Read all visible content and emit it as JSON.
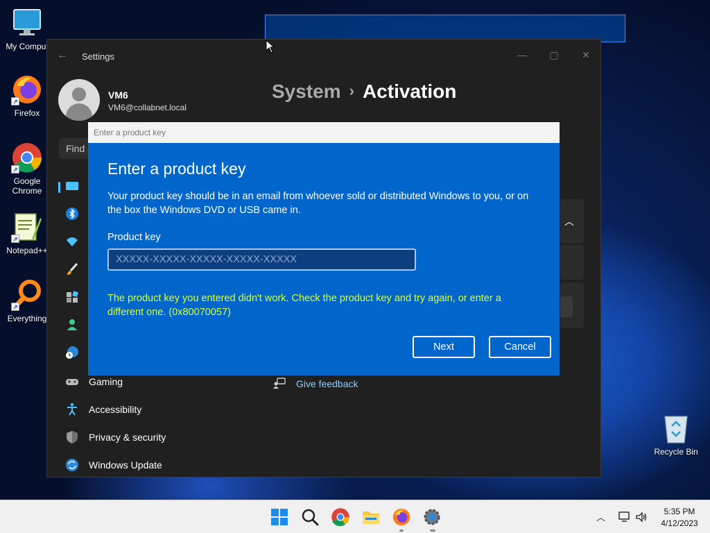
{
  "desktop": {
    "icons": [
      {
        "label": "My Comput"
      },
      {
        "label": "Firefox"
      },
      {
        "label": "Google Chrome"
      },
      {
        "label": "Notepad++"
      },
      {
        "label": "Everything"
      }
    ],
    "recycle_bin_label": "Recycle Bin"
  },
  "settings": {
    "window_title": "Settings",
    "user": {
      "name": "VM6",
      "email": "VM6@collabnet.local"
    },
    "breadcrumb": {
      "parent": "System",
      "separator": "›",
      "current": "Activation"
    },
    "find_placeholder": "Find a",
    "nav": {
      "gaming": "Gaming",
      "accessibility": "Accessibility",
      "privacy": "Privacy & security",
      "windows_update": "Windows Update"
    },
    "feedback_label": "Give feedback"
  },
  "dialog": {
    "titlebar_text": "Enter a product key",
    "heading": "Enter a product key",
    "description": "Your product key should be in an email from whoever sold or distributed Windows to you, or on the box the Windows DVD or USB came in.",
    "field_label": "Product key",
    "input_placeholder": "XXXXX-XXXXX-XXXXX-XXXXX-XXXXX",
    "input_value": "",
    "error": "The product key you entered didn't work. Check the product key and try again, or enter a different one. (0x80070057)",
    "next_label": "Next",
    "cancel_label": "Cancel"
  },
  "taskbar": {
    "time": "5:35 PM",
    "date": "4/12/2023"
  },
  "colors": {
    "dialog_bg": "#0066cc",
    "error_text": "#d6ff3c",
    "settings_bg": "#202020",
    "accent": "#4cc2ff"
  }
}
